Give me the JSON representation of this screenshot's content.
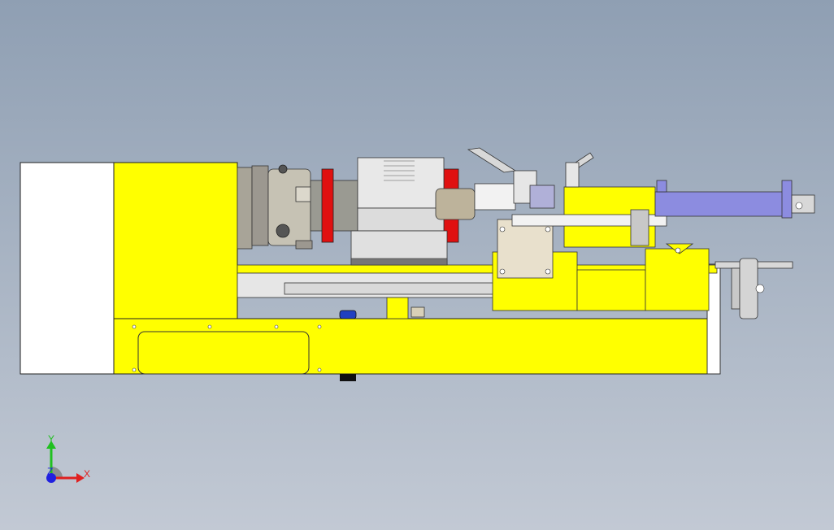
{
  "viewport": {
    "colors": {
      "background_top": "#8f9fb3",
      "background_bottom": "#c2c9d4",
      "machine_yellow": "#ffff00",
      "chuck_gray": "#b8b4a8",
      "accent_red": "#e01010",
      "tailstock_blue": "#8c8ce0",
      "handle_blue": "#2040c0"
    }
  },
  "triad": {
    "x_label": "X",
    "y_label": "Y",
    "z_label": "Z",
    "x_color": "#e02020",
    "y_color": "#20c020",
    "z_color": "#2020e0"
  }
}
